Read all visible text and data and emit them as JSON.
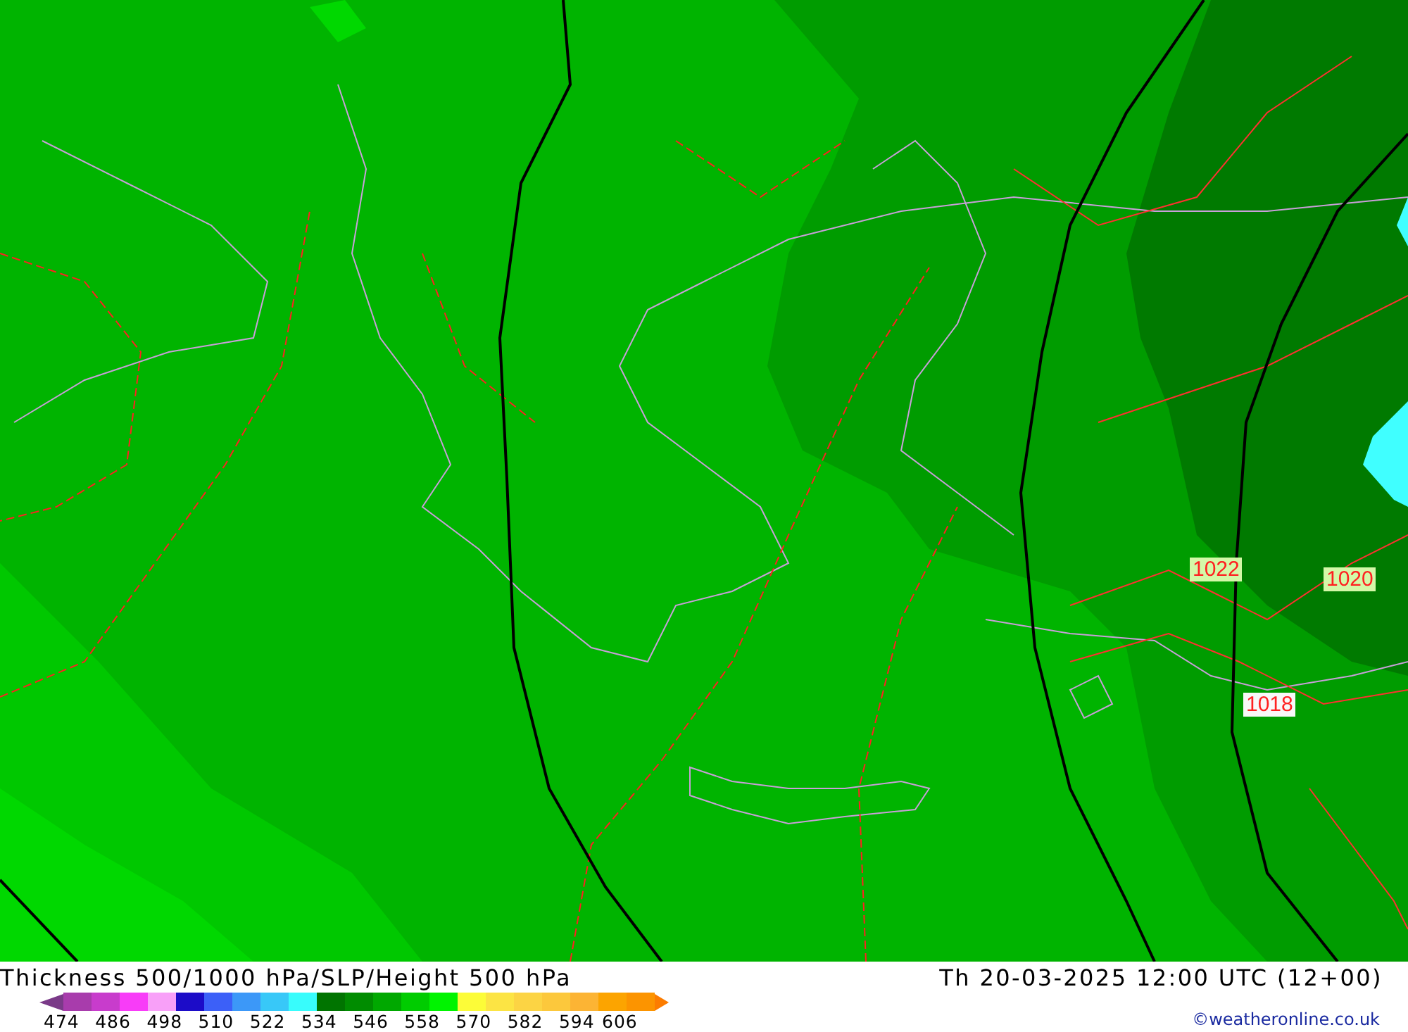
{
  "map": {
    "isobar_labels": [
      {
        "text": "1022",
        "color": "#d4f8a8"
      },
      {
        "text": "1020",
        "color": "#d4f8a8"
      },
      {
        "text": "1018",
        "color": "#f8f8f8"
      }
    ]
  },
  "footer": {
    "title": "Thickness 500/1000 hPa/SLP/Height 500 hPa",
    "valid_time": "Th 20-03-2025 12:00 UTC (12+00)",
    "credit": "©weatheronline.co.uk",
    "legend": {
      "bins": [
        {
          "kind": "arrow",
          "color": "#7a3a88"
        },
        {
          "kind": "bin",
          "color": "#a83cac"
        },
        {
          "kind": "bin",
          "color": "#c83ccc"
        },
        {
          "kind": "bin",
          "color": "#f83cf8"
        },
        {
          "kind": "bin",
          "color": "#f8a0f8"
        },
        {
          "kind": "bin",
          "color": "#1c0cc8"
        },
        {
          "kind": "bin",
          "color": "#3c60f8"
        },
        {
          "kind": "bin",
          "color": "#3c98f8"
        },
        {
          "kind": "bin",
          "color": "#38c8f8"
        },
        {
          "kind": "bin",
          "color": "#38fcfc"
        },
        {
          "kind": "bin",
          "color": "#007400"
        },
        {
          "kind": "bin",
          "color": "#008c00"
        },
        {
          "kind": "bin",
          "color": "#00a800"
        },
        {
          "kind": "bin",
          "color": "#00cc00"
        },
        {
          "kind": "bin",
          "color": "#00f400"
        },
        {
          "kind": "bin",
          "color": "#fcfc38"
        },
        {
          "kind": "bin",
          "color": "#fce444"
        },
        {
          "kind": "bin",
          "color": "#fcd444"
        },
        {
          "kind": "bin",
          "color": "#fcc83c"
        },
        {
          "kind": "bin",
          "color": "#fcb434"
        },
        {
          "kind": "bin",
          "color": "#fca400"
        },
        {
          "kind": "bin",
          "color": "#fc9400"
        },
        {
          "kind": "arrow",
          "color": "#fc7c00"
        }
      ],
      "labels": [
        "474",
        "486",
        "498",
        "510",
        "522",
        "534",
        "546",
        "558",
        "570",
        "582",
        "594",
        "606"
      ]
    }
  }
}
